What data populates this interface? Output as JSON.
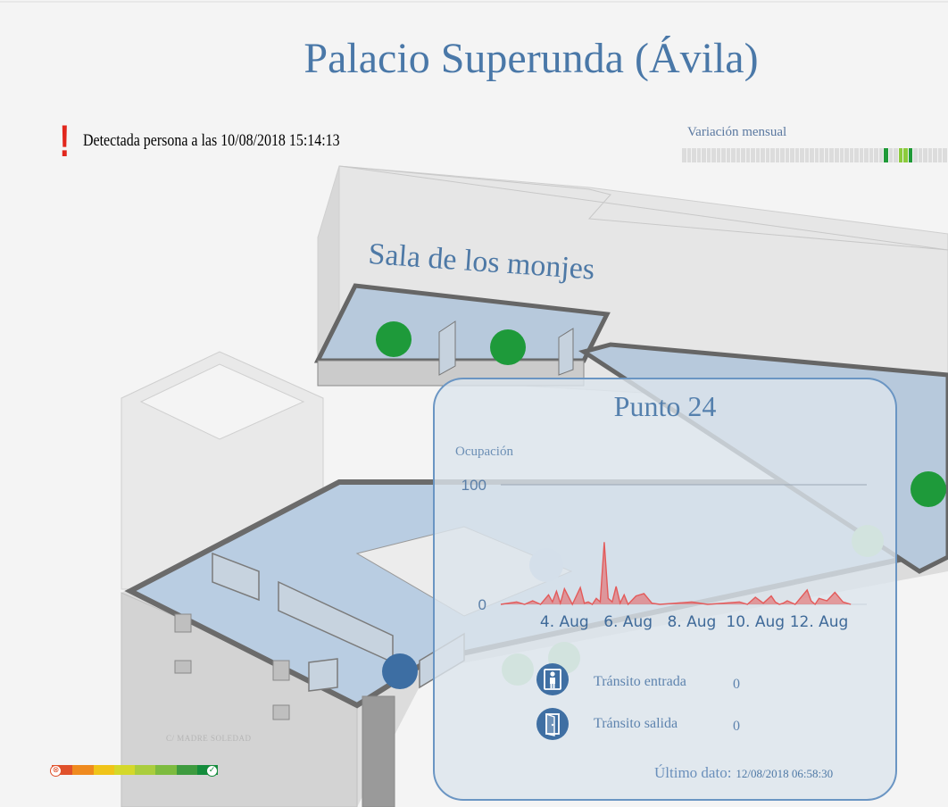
{
  "header": {
    "title": "Palacio Superunda (Ávila)"
  },
  "alert": {
    "icon": "exclamation-icon",
    "text": "Detectada persona a las 10/08/2018 15:14:13",
    "color": "#e1261c"
  },
  "monthly_variation": {
    "title": "Variación mensual",
    "cells": [
      0,
      0,
      0,
      0,
      0,
      0,
      0,
      0,
      0,
      0,
      0,
      0,
      0,
      0,
      0,
      0,
      0,
      0,
      0,
      0,
      0,
      0,
      0,
      0,
      0,
      0,
      0,
      0,
      0,
      0,
      0,
      0,
      0,
      0,
      0,
      0,
      0,
      0,
      0,
      0,
      0,
      2,
      0,
      0,
      1,
      1,
      2,
      0,
      0,
      0,
      0,
      0,
      0,
      0
    ],
    "colors": {
      "0": "#dcdcdc",
      "1": "#8ccb3c",
      "2": "#1f9a38"
    }
  },
  "map": {
    "room_label": "Sala de los monjes",
    "street_label": "C/ MADRE SOLEDAD",
    "sensors": [
      {
        "status": "occupied",
        "color": "#1e9a3a"
      },
      {
        "status": "occupied",
        "color": "#1e9a3a"
      },
      {
        "status": "occupied",
        "color": "#1e9a3a"
      },
      {
        "status": "free",
        "color": "#a8dca6"
      },
      {
        "status": "free",
        "color": "#a8dca6"
      },
      {
        "status": "free",
        "color": "#a8dca6"
      },
      {
        "status": "selected",
        "color": "#3d6ea3"
      },
      {
        "status": "selected-faded",
        "color": "#b4c6e0"
      }
    ]
  },
  "scale": {
    "colors": [
      "#e0512b",
      "#ef8a1f",
      "#f0c419",
      "#d4d82a",
      "#aacd3d",
      "#7dbb3f",
      "#3e9b3f",
      "#148c3c"
    ]
  },
  "panel": {
    "title": "Punto 24",
    "y_axis_label": "Ocupación",
    "transit_in": {
      "icon": "person-entering-icon",
      "label": "Tránsito entrada",
      "value": "0"
    },
    "transit_out": {
      "icon": "door-exit-icon",
      "label": "Tránsito salida",
      "value": "0"
    },
    "last_data": {
      "label": "Último dato:",
      "timestamp": "12/08/2018 06:58:30"
    }
  },
  "chart_data": {
    "type": "area",
    "ylabel": "Ocupación",
    "ylim": [
      0,
      100
    ],
    "y_ticks": [
      "100",
      "0"
    ],
    "x_ticks": [
      "4. Aug",
      "6. Aug",
      "8. Aug",
      "10. Aug",
      "12. Aug"
    ],
    "xlim": [
      "2018-08-02T00:00",
      "2018-08-13T12:00"
    ],
    "series": [
      {
        "color": "#e35a5a",
        "x": [
          "2018-08-02T00:00",
          "2018-08-02T12:00",
          "2018-08-02T18:00",
          "2018-08-03T00:00",
          "2018-08-03T06:00",
          "2018-08-03T12:00",
          "2018-08-03T15:00",
          "2018-08-03T18:00",
          "2018-08-03T21:00",
          "2018-08-04T00:00",
          "2018-08-04T06:00",
          "2018-08-04T12:00",
          "2018-08-04T15:00",
          "2018-08-04T18:00",
          "2018-08-04T21:00",
          "2018-08-05T00:00",
          "2018-08-05T03:00",
          "2018-08-05T06:00",
          "2018-08-05T09:00",
          "2018-08-05T12:00",
          "2018-08-05T15:00",
          "2018-08-05T18:00",
          "2018-08-05T21:00",
          "2018-08-06T00:00",
          "2018-08-06T06:00",
          "2018-08-06T12:00",
          "2018-08-06T18:00",
          "2018-08-07T00:00",
          "2018-08-07T12:00",
          "2018-08-08T00:00",
          "2018-08-08T12:00",
          "2018-08-09T00:00",
          "2018-08-09T12:00",
          "2018-08-09T18:00",
          "2018-08-10T00:00",
          "2018-08-10T06:00",
          "2018-08-10T12:00",
          "2018-08-10T15:00",
          "2018-08-10T18:00",
          "2018-08-10T21:00",
          "2018-08-11T00:00",
          "2018-08-11T06:00",
          "2018-08-11T12:00",
          "2018-08-11T15:00",
          "2018-08-11T18:00",
          "2018-08-11T21:00",
          "2018-08-12T00:00",
          "2018-08-12T06:00",
          "2018-08-12T12:00",
          "2018-08-12T18:00",
          "2018-08-13T00:00"
        ],
        "y": [
          0,
          2,
          0,
          3,
          0,
          8,
          2,
          11,
          1,
          13,
          0,
          14,
          1,
          2,
          0,
          5,
          2,
          52,
          5,
          2,
          15,
          1,
          8,
          0,
          7,
          9,
          1,
          0,
          1,
          2,
          0,
          1,
          2,
          0,
          6,
          1,
          7,
          2,
          0,
          1,
          3,
          0,
          8,
          12,
          3,
          0,
          5,
          3,
          10,
          2,
          0
        ]
      }
    ]
  }
}
